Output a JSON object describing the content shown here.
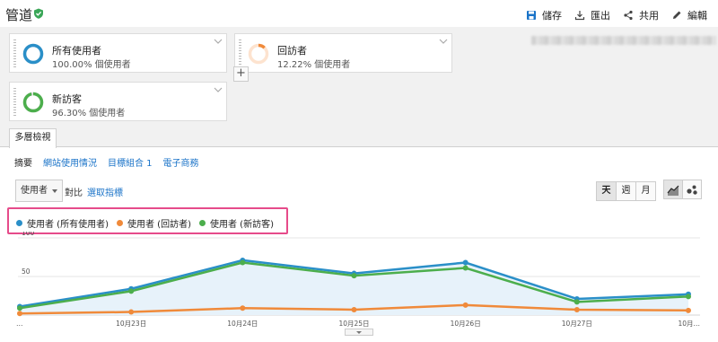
{
  "header": {
    "title": "管道",
    "actions": {
      "save": "儲存",
      "export": "匯出",
      "share": "共用",
      "edit": "編輯"
    }
  },
  "segments": [
    {
      "name": "所有使用者",
      "sub": "100.00% 個使用者",
      "color": "#2a8fc8",
      "share": 1.0
    },
    {
      "name": "回訪者",
      "sub": "12.22% 個使用者",
      "color": "#f08a3a",
      "share": 0.1222
    },
    {
      "name": "新訪客",
      "sub": "96.30% 個使用者",
      "color": "#4cae4c",
      "share": 0.963
    }
  ],
  "add_segment": "+",
  "tab": {
    "label": "多層檢視"
  },
  "subnav": {
    "summary": "摘要",
    "site_usage": "網站使用情況",
    "goal_set": "目標組合 1",
    "ecommerce": "電子商務"
  },
  "controls": {
    "metric": "使用者",
    "compare": "對比",
    "select_metric": "選取指標"
  },
  "period": {
    "day": "天",
    "week": "週",
    "month": "月",
    "active": "day"
  },
  "legend": [
    {
      "label": "使用者 (所有使用者)",
      "color": "#2a8fc8"
    },
    {
      "label": "使用者 (回訪者)",
      "color": "#f08a3a"
    },
    {
      "label": "使用者 (新訪客)",
      "color": "#4cae4c"
    }
  ],
  "chart_data": {
    "type": "line",
    "x": [
      "…",
      "10月23日",
      "10月24日",
      "10月25日",
      "10月26日",
      "10月27日",
      "10月…"
    ],
    "x_tick_labels": [
      "…",
      "10月23日",
      "10月24日",
      "10月25日",
      "10月26日",
      "10月27日",
      "10月…"
    ],
    "y_ticks": [
      100,
      50
    ],
    "ylim": [
      0,
      100
    ],
    "grid": true,
    "series": [
      {
        "name": "使用者 (所有使用者)",
        "color": "#2a8fc8",
        "values": [
          11,
          34,
          71,
          54,
          68,
          21,
          27
        ],
        "area": true
      },
      {
        "name": "使用者 (回訪者)",
        "color": "#f08a3a",
        "values": [
          2,
          4,
          9,
          7,
          13,
          7,
          6
        ]
      },
      {
        "name": "使用者 (新訪客)",
        "color": "#4cae4c",
        "values": [
          9,
          31,
          68,
          51,
          61,
          17,
          24
        ]
      }
    ]
  }
}
